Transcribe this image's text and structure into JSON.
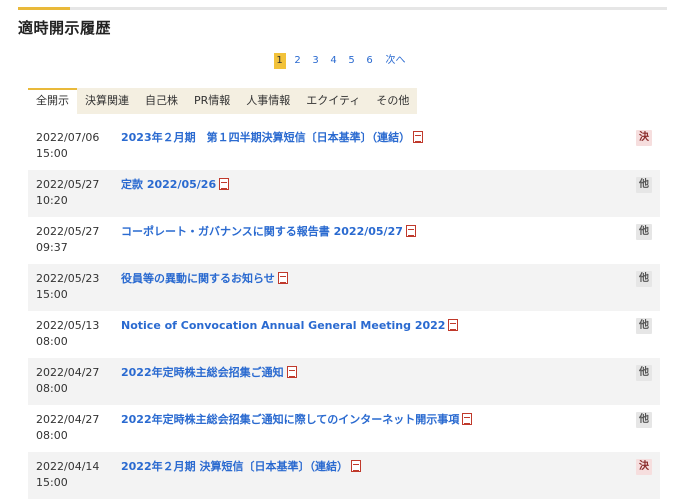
{
  "section": {
    "title": "適時開示履歴"
  },
  "pagination": {
    "pages": [
      "1",
      "2",
      "3",
      "4",
      "5",
      "6"
    ],
    "active": "1",
    "next_label": "次へ"
  },
  "tabs": [
    {
      "label": "全開示",
      "active": true
    },
    {
      "label": "決算関連",
      "active": false
    },
    {
      "label": "自己株",
      "active": false
    },
    {
      "label": "PR情報",
      "active": false
    },
    {
      "label": "人事情報",
      "active": false
    },
    {
      "label": "エクイティ",
      "active": false
    },
    {
      "label": "その他",
      "active": false
    }
  ],
  "disclosures": [
    {
      "date": "2022/07/06",
      "time": "15:00",
      "title": "2023年２月期　第１四半期決算短信〔日本基準〕（連結）",
      "category": "決"
    },
    {
      "date": "2022/05/27",
      "time": "10:20",
      "title": "定款 2022/05/26",
      "category": "他"
    },
    {
      "date": "2022/05/27",
      "time": "09:37",
      "title": "コーポレート・ガバナンスに関する報告書 2022/05/27",
      "category": "他"
    },
    {
      "date": "2022/05/23",
      "time": "15:00",
      "title": "役員等の異動に関するお知らせ",
      "category": "他"
    },
    {
      "date": "2022/05/13",
      "time": "08:00",
      "title": "Notice of Convocation Annual General Meeting 2022",
      "category": "他"
    },
    {
      "date": "2022/04/27",
      "time": "08:00",
      "title": "2022年定時株主総会招集ご通知",
      "category": "他"
    },
    {
      "date": "2022/04/27",
      "time": "08:00",
      "title": "2022年定時株主総会招集ご通知に際してのインターネット開示事項",
      "category": "他"
    },
    {
      "date": "2022/04/14",
      "time": "15:00",
      "title": "2022年２月期 決算短信〔日本基準〕（連結）",
      "category": "決"
    }
  ]
}
